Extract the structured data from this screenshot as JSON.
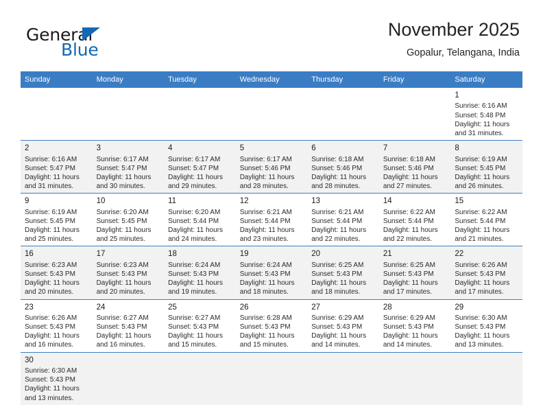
{
  "brand": {
    "name_top": "General",
    "name_bottom": "Blue",
    "accent_color": "#1268b3"
  },
  "header": {
    "title": "November 2025",
    "subtitle": "Gopalur, Telangana, India"
  },
  "theme": {
    "header_row_bg": "#3b7dc4",
    "row_shade_bg": "#f2f2f2",
    "row_plain_bg": "#ffffff",
    "grid_line": "#3b7dc4"
  },
  "weekdays": [
    "Sunday",
    "Monday",
    "Tuesday",
    "Wednesday",
    "Thursday",
    "Friday",
    "Saturday"
  ],
  "weeks": [
    [
      {
        "day": "",
        "empty": true
      },
      {
        "day": "",
        "empty": true
      },
      {
        "day": "",
        "empty": true
      },
      {
        "day": "",
        "empty": true
      },
      {
        "day": "",
        "empty": true
      },
      {
        "day": "",
        "empty": true
      },
      {
        "day": "1",
        "sunrise": "Sunrise: 6:16 AM",
        "sunset": "Sunset: 5:48 PM",
        "daylight1": "Daylight: 11 hours",
        "daylight2": "and 31 minutes."
      }
    ],
    [
      {
        "day": "2",
        "sunrise": "Sunrise: 6:16 AM",
        "sunset": "Sunset: 5:47 PM",
        "daylight1": "Daylight: 11 hours",
        "daylight2": "and 31 minutes."
      },
      {
        "day": "3",
        "sunrise": "Sunrise: 6:17 AM",
        "sunset": "Sunset: 5:47 PM",
        "daylight1": "Daylight: 11 hours",
        "daylight2": "and 30 minutes."
      },
      {
        "day": "4",
        "sunrise": "Sunrise: 6:17 AM",
        "sunset": "Sunset: 5:47 PM",
        "daylight1": "Daylight: 11 hours",
        "daylight2": "and 29 minutes."
      },
      {
        "day": "5",
        "sunrise": "Sunrise: 6:17 AM",
        "sunset": "Sunset: 5:46 PM",
        "daylight1": "Daylight: 11 hours",
        "daylight2": "and 28 minutes."
      },
      {
        "day": "6",
        "sunrise": "Sunrise: 6:18 AM",
        "sunset": "Sunset: 5:46 PM",
        "daylight1": "Daylight: 11 hours",
        "daylight2": "and 28 minutes."
      },
      {
        "day": "7",
        "sunrise": "Sunrise: 6:18 AM",
        "sunset": "Sunset: 5:46 PM",
        "daylight1": "Daylight: 11 hours",
        "daylight2": "and 27 minutes."
      },
      {
        "day": "8",
        "sunrise": "Sunrise: 6:19 AM",
        "sunset": "Sunset: 5:45 PM",
        "daylight1": "Daylight: 11 hours",
        "daylight2": "and 26 minutes."
      }
    ],
    [
      {
        "day": "9",
        "sunrise": "Sunrise: 6:19 AM",
        "sunset": "Sunset: 5:45 PM",
        "daylight1": "Daylight: 11 hours",
        "daylight2": "and 25 minutes."
      },
      {
        "day": "10",
        "sunrise": "Sunrise: 6:20 AM",
        "sunset": "Sunset: 5:45 PM",
        "daylight1": "Daylight: 11 hours",
        "daylight2": "and 25 minutes."
      },
      {
        "day": "11",
        "sunrise": "Sunrise: 6:20 AM",
        "sunset": "Sunset: 5:44 PM",
        "daylight1": "Daylight: 11 hours",
        "daylight2": "and 24 minutes."
      },
      {
        "day": "12",
        "sunrise": "Sunrise: 6:21 AM",
        "sunset": "Sunset: 5:44 PM",
        "daylight1": "Daylight: 11 hours",
        "daylight2": "and 23 minutes."
      },
      {
        "day": "13",
        "sunrise": "Sunrise: 6:21 AM",
        "sunset": "Sunset: 5:44 PM",
        "daylight1": "Daylight: 11 hours",
        "daylight2": "and 22 minutes."
      },
      {
        "day": "14",
        "sunrise": "Sunrise: 6:22 AM",
        "sunset": "Sunset: 5:44 PM",
        "daylight1": "Daylight: 11 hours",
        "daylight2": "and 22 minutes."
      },
      {
        "day": "15",
        "sunrise": "Sunrise: 6:22 AM",
        "sunset": "Sunset: 5:44 PM",
        "daylight1": "Daylight: 11 hours",
        "daylight2": "and 21 minutes."
      }
    ],
    [
      {
        "day": "16",
        "sunrise": "Sunrise: 6:23 AM",
        "sunset": "Sunset: 5:43 PM",
        "daylight1": "Daylight: 11 hours",
        "daylight2": "and 20 minutes."
      },
      {
        "day": "17",
        "sunrise": "Sunrise: 6:23 AM",
        "sunset": "Sunset: 5:43 PM",
        "daylight1": "Daylight: 11 hours",
        "daylight2": "and 20 minutes."
      },
      {
        "day": "18",
        "sunrise": "Sunrise: 6:24 AM",
        "sunset": "Sunset: 5:43 PM",
        "daylight1": "Daylight: 11 hours",
        "daylight2": "and 19 minutes."
      },
      {
        "day": "19",
        "sunrise": "Sunrise: 6:24 AM",
        "sunset": "Sunset: 5:43 PM",
        "daylight1": "Daylight: 11 hours",
        "daylight2": "and 18 minutes."
      },
      {
        "day": "20",
        "sunrise": "Sunrise: 6:25 AM",
        "sunset": "Sunset: 5:43 PM",
        "daylight1": "Daylight: 11 hours",
        "daylight2": "and 18 minutes."
      },
      {
        "day": "21",
        "sunrise": "Sunrise: 6:25 AM",
        "sunset": "Sunset: 5:43 PM",
        "daylight1": "Daylight: 11 hours",
        "daylight2": "and 17 minutes."
      },
      {
        "day": "22",
        "sunrise": "Sunrise: 6:26 AM",
        "sunset": "Sunset: 5:43 PM",
        "daylight1": "Daylight: 11 hours",
        "daylight2": "and 17 minutes."
      }
    ],
    [
      {
        "day": "23",
        "sunrise": "Sunrise: 6:26 AM",
        "sunset": "Sunset: 5:43 PM",
        "daylight1": "Daylight: 11 hours",
        "daylight2": "and 16 minutes."
      },
      {
        "day": "24",
        "sunrise": "Sunrise: 6:27 AM",
        "sunset": "Sunset: 5:43 PM",
        "daylight1": "Daylight: 11 hours",
        "daylight2": "and 16 minutes."
      },
      {
        "day": "25",
        "sunrise": "Sunrise: 6:27 AM",
        "sunset": "Sunset: 5:43 PM",
        "daylight1": "Daylight: 11 hours",
        "daylight2": "and 15 minutes."
      },
      {
        "day": "26",
        "sunrise": "Sunrise: 6:28 AM",
        "sunset": "Sunset: 5:43 PM",
        "daylight1": "Daylight: 11 hours",
        "daylight2": "and 15 minutes."
      },
      {
        "day": "27",
        "sunrise": "Sunrise: 6:29 AM",
        "sunset": "Sunset: 5:43 PM",
        "daylight1": "Daylight: 11 hours",
        "daylight2": "and 14 minutes."
      },
      {
        "day": "28",
        "sunrise": "Sunrise: 6:29 AM",
        "sunset": "Sunset: 5:43 PM",
        "daylight1": "Daylight: 11 hours",
        "daylight2": "and 14 minutes."
      },
      {
        "day": "29",
        "sunrise": "Sunrise: 6:30 AM",
        "sunset": "Sunset: 5:43 PM",
        "daylight1": "Daylight: 11 hours",
        "daylight2": "and 13 minutes."
      }
    ],
    [
      {
        "day": "30",
        "sunrise": "Sunrise: 6:30 AM",
        "sunset": "Sunset: 5:43 PM",
        "daylight1": "Daylight: 11 hours",
        "daylight2": "and 13 minutes."
      },
      {
        "day": "",
        "empty": true
      },
      {
        "day": "",
        "empty": true
      },
      {
        "day": "",
        "empty": true
      },
      {
        "day": "",
        "empty": true
      },
      {
        "day": "",
        "empty": true
      },
      {
        "day": "",
        "empty": true
      }
    ]
  ]
}
